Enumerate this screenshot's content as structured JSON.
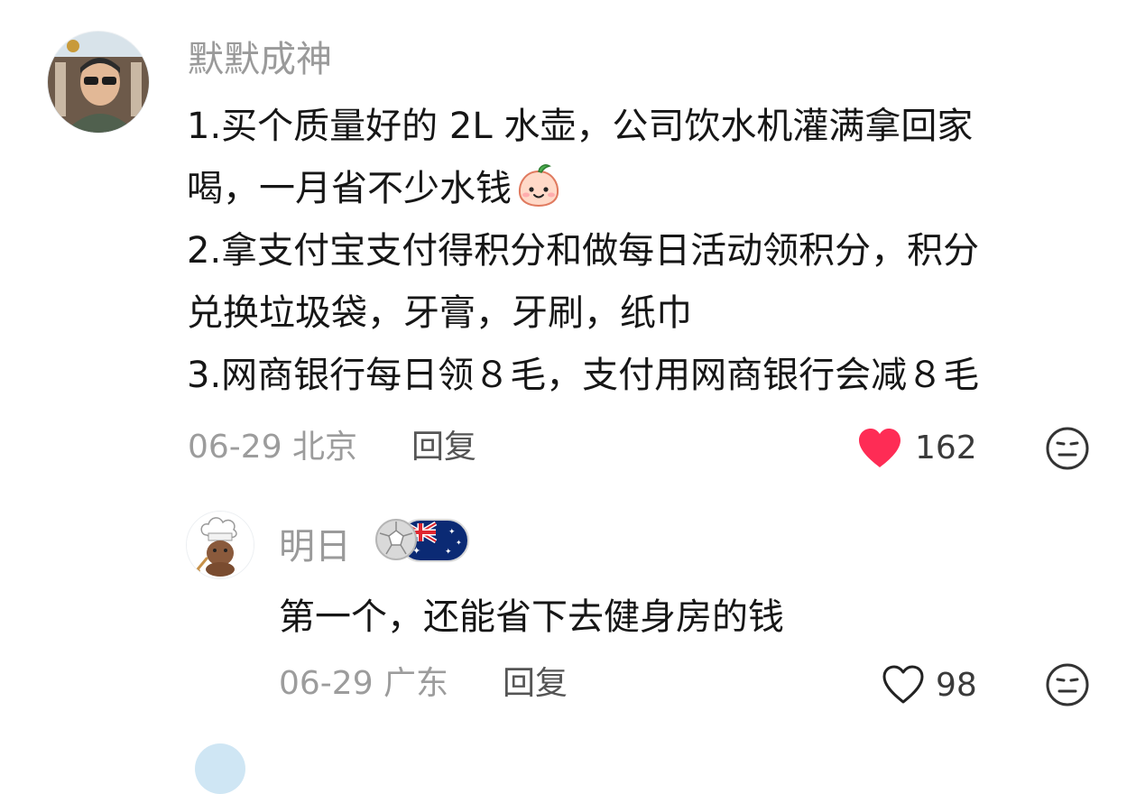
{
  "comment": {
    "author": "默默成神",
    "lines": [
      "1.买个质量好的 2L 水壶，公司饮水机灌满拿回家",
      "喝，一月省不少水钱",
      "2.拿支付宝支付得积分和做每日活动领积分，积分",
      "兑换垃圾袋，牙膏，牙刷，纸巾",
      "3.网商银行每日领８毛，支付用网商银行会减８毛"
    ],
    "inline_emoji": "peach-face-emoji",
    "date_location": "06-29 北京",
    "reply_label": "回复",
    "like_count": "162",
    "liked": true,
    "like_color": "#fe2c55",
    "icons": {
      "like": "heart-filled-icon",
      "dislike": "meh-face-icon"
    }
  },
  "sub_reply": {
    "author": "明日",
    "badge": "soccer-australia-badge",
    "text": "第一个，还能省下去健身房的钱",
    "date_location": "06-29 广东",
    "reply_label": "回复",
    "like_count": "98",
    "liked": false,
    "icons": {
      "like": "heart-outline-icon",
      "dislike": "meh-face-icon"
    }
  }
}
